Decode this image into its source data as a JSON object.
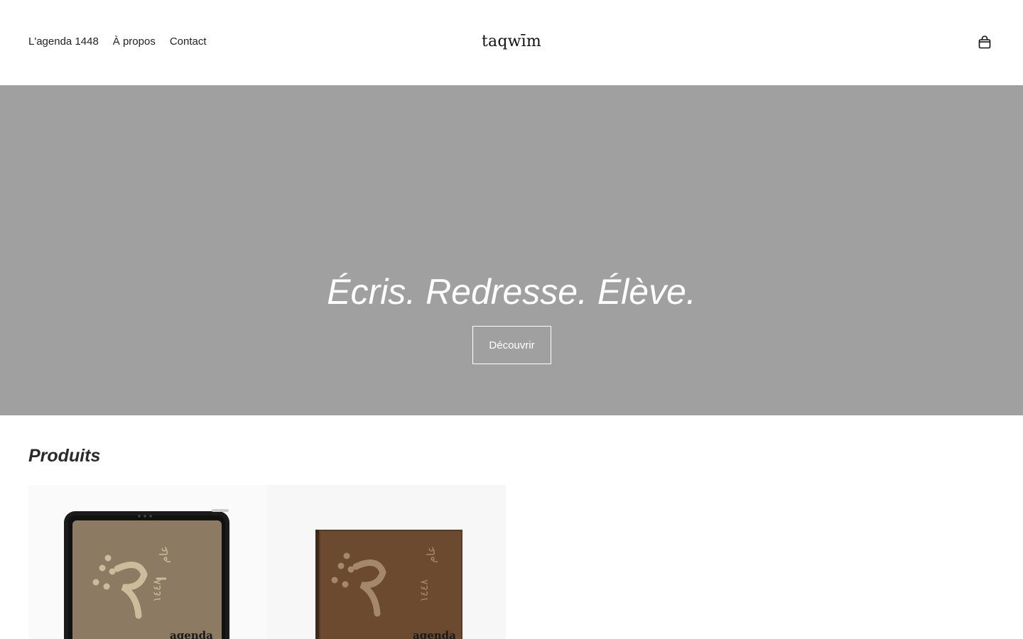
{
  "header": {
    "nav": [
      {
        "label": "L'agenda 1448"
      },
      {
        "label": "À propos"
      },
      {
        "label": "Contact"
      }
    ],
    "logo": "taqwīm",
    "cart_icon": "shopping-bag-icon"
  },
  "hero": {
    "title": "Écris. Redresse. Élève.",
    "button_label": "Découvrir",
    "background_color": "#a0a0a0"
  },
  "products": {
    "title": "Produits",
    "items": [
      {
        "image": "ipad-agenda-image",
        "cover_text": "agenda"
      },
      {
        "image": "book-agenda-image",
        "cover_text": "agenda"
      }
    ]
  }
}
